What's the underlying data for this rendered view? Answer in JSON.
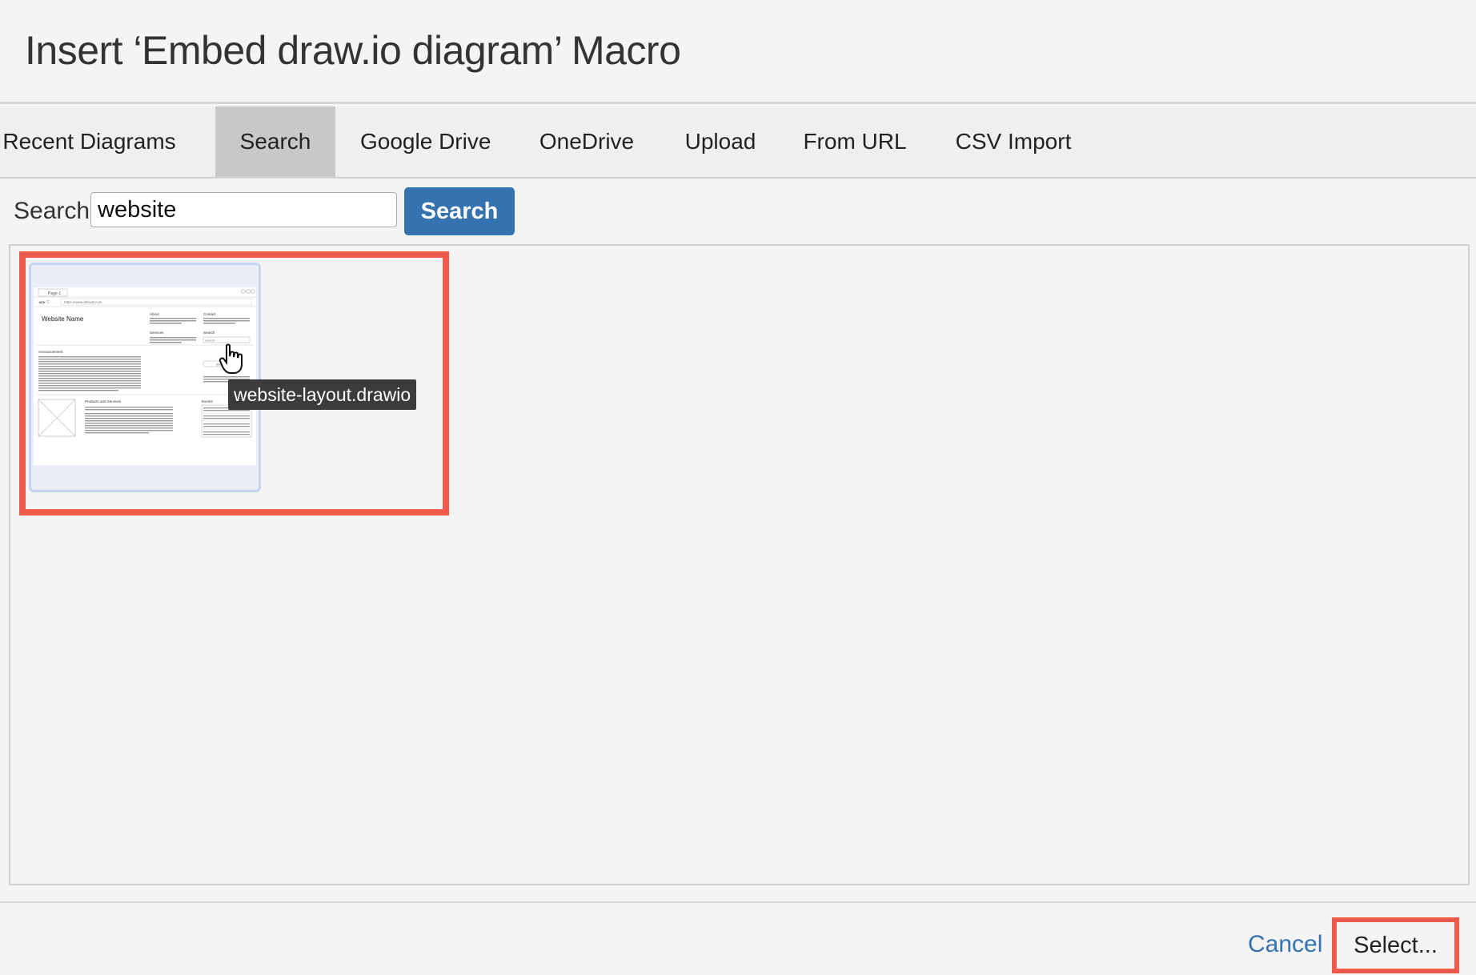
{
  "dialog": {
    "title": "Insert ‘Embed draw.io diagram’ Macro"
  },
  "tabs": [
    {
      "label": "Recent Diagrams",
      "active": false
    },
    {
      "label": "Search",
      "active": true
    },
    {
      "label": "Google Drive",
      "active": false
    },
    {
      "label": "OneDrive",
      "active": false
    },
    {
      "label": "Upload",
      "active": false
    },
    {
      "label": "From URL",
      "active": false
    },
    {
      "label": "CSV Import",
      "active": false
    }
  ],
  "search": {
    "label": "Search",
    "value": "website",
    "button_label": "Search"
  },
  "results": [
    {
      "tooltip": "website-layout.drawio",
      "preview": {
        "page_tab": "Page-1",
        "url": "https://www.default.com",
        "site_name": "Website Name",
        "about": "About",
        "contact": "Contact",
        "services": "Services",
        "search": "Search",
        "search_placeholder": "Search",
        "announcement": "Announcement",
        "shop": "Shop",
        "products": "Products and Services",
        "events": "Events"
      }
    }
  ],
  "footer": {
    "cancel_label": "Cancel",
    "select_label": "Select..."
  },
  "colors": {
    "accent": "#3572b0",
    "highlight": "#f05a4b",
    "active_tab": "#c8c8c8"
  }
}
